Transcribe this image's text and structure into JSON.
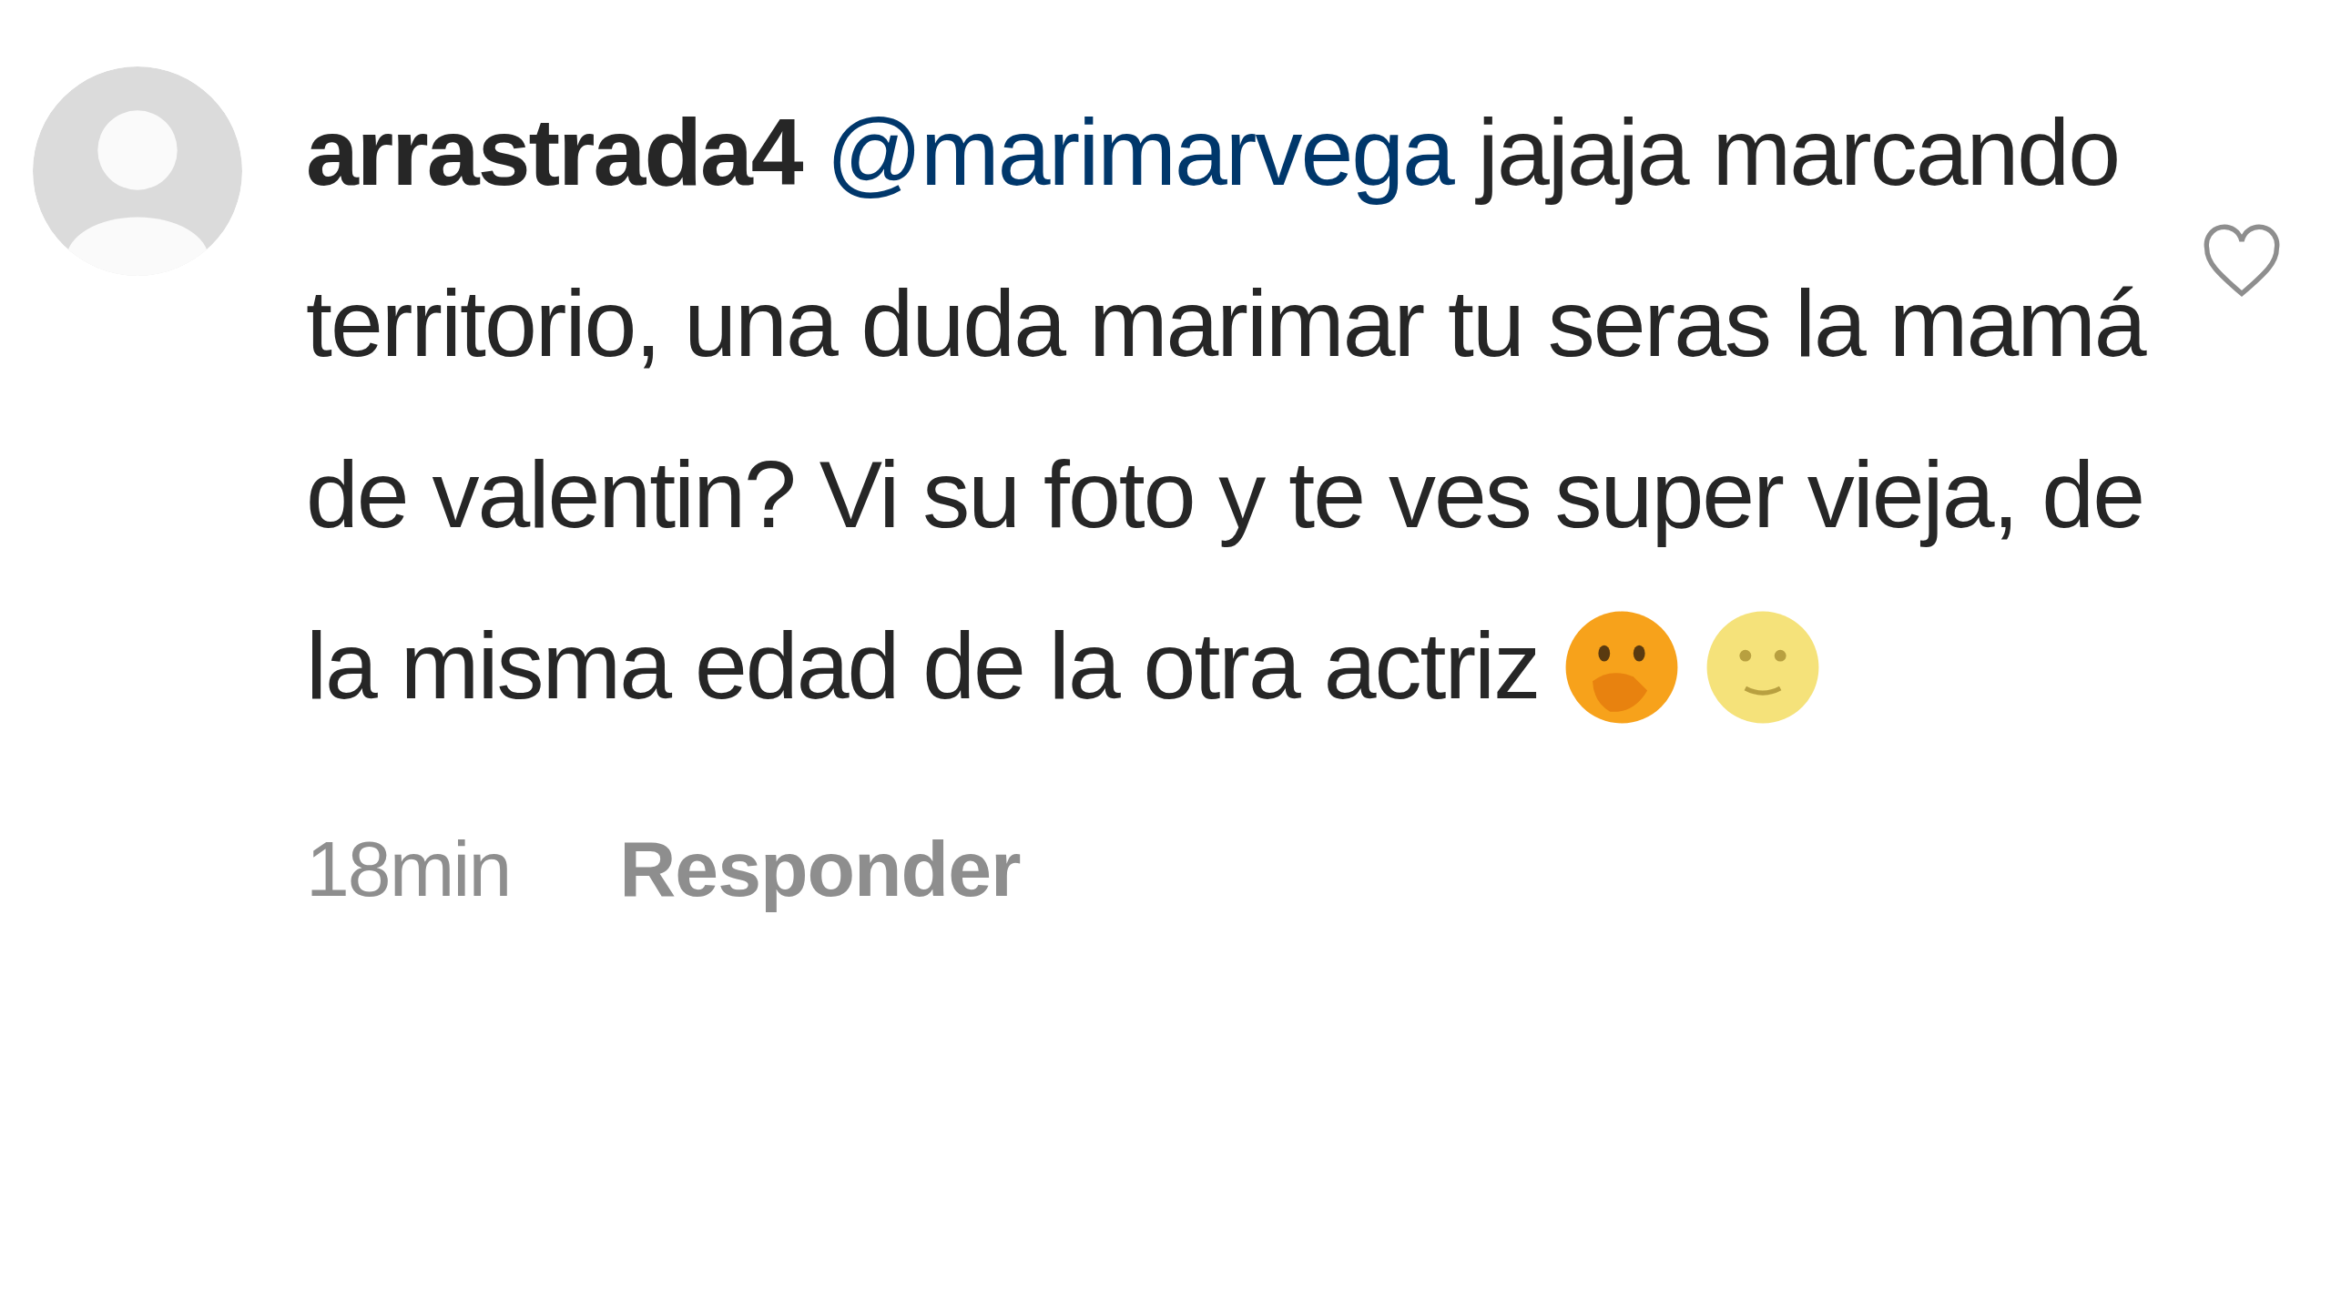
{
  "comment": {
    "username": "arrastrada4",
    "mention": "@marimarvega",
    "text": "jajaja marcando territorio, una duda marimar tu seras la mamá de valentin? Vi su foto y te ves super vieja, de la misma edad de la otra actriz",
    "liked": false,
    "time": "18min",
    "reply": "Responder"
  }
}
